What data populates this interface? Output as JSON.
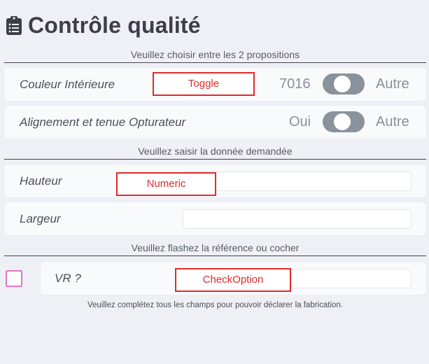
{
  "header": {
    "title": "Contrôle qualité",
    "icon": "clipboard-list-icon"
  },
  "sections": {
    "choice": "Veuillez choisir entre les 2 propositions",
    "data": "Veuillez saisir la donnée demandée",
    "scan": "Veuillez flashez la référence ou cocher"
  },
  "rows": {
    "couleur": {
      "label": "Couleur Intérieure",
      "option_left": "7016",
      "option_right": "Autre"
    },
    "alignement": {
      "label": "Alignement et tenue Opturateur",
      "option_left": "Oui",
      "option_right": "Autre"
    },
    "hauteur": {
      "label": "Hauteur",
      "value": ""
    },
    "largeur": {
      "label": "Largeur",
      "value": ""
    },
    "vr": {
      "label": "VR ?",
      "value": "",
      "checked": false
    }
  },
  "annotations": {
    "toggle": "Toggle",
    "numeric": "Numeric",
    "check_option": "CheckOption"
  },
  "footer": {
    "note": "Veuillez complétez tous les champs pour pouvoir déclarer la fabrication."
  },
  "colors": {
    "background": "#eef0f5",
    "title": "#3b3f4b",
    "toggle": "#8a929c",
    "annotation_red": "#e02a2a",
    "checkbox_border": "#e874c4"
  }
}
